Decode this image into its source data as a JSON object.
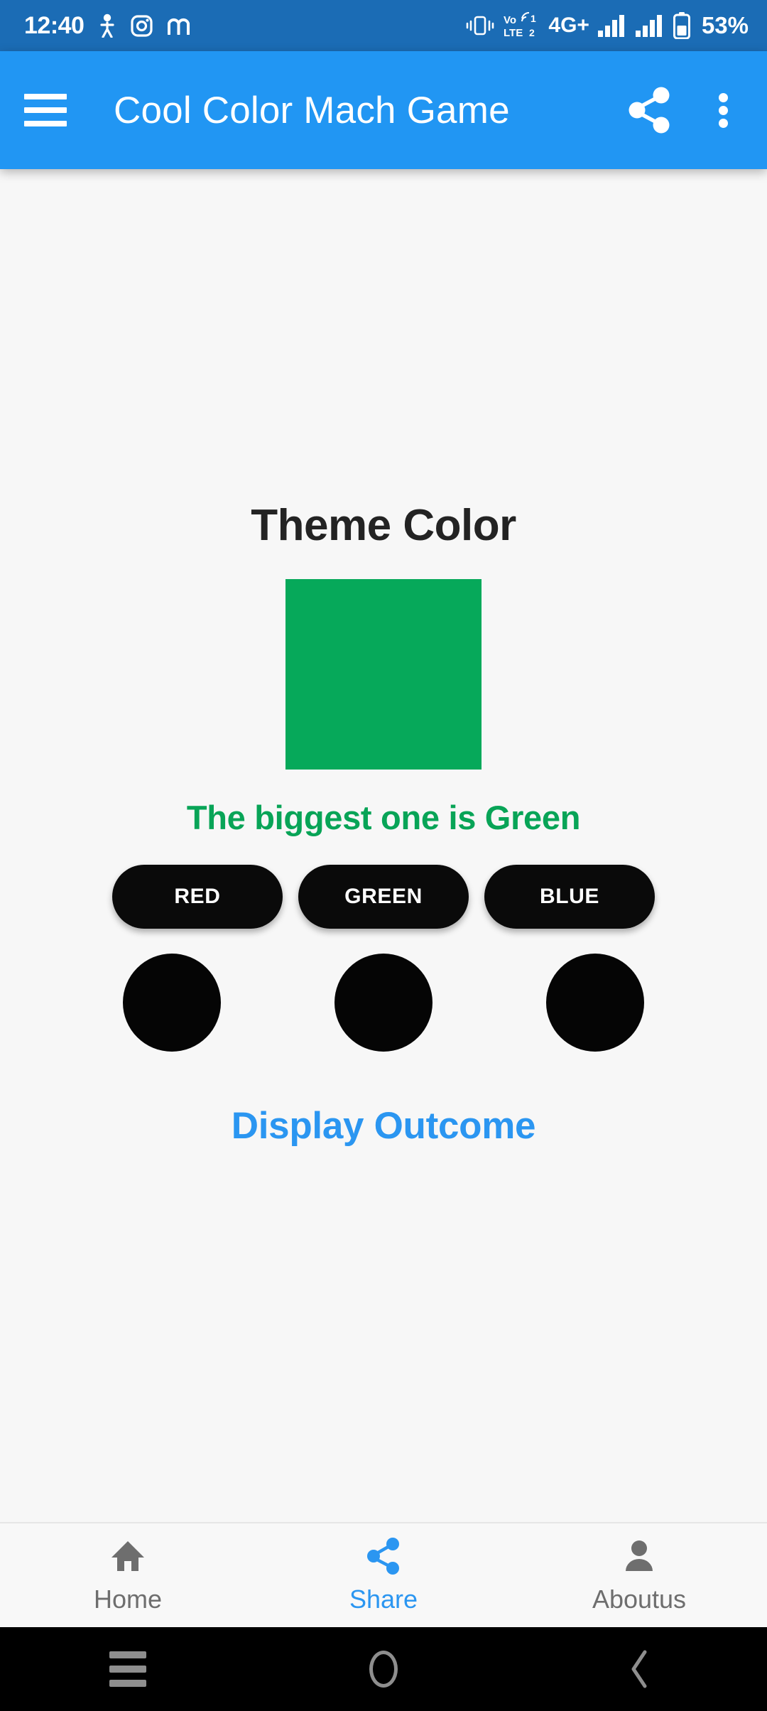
{
  "status_bar": {
    "clock": "12:40",
    "battery_percent": "53%",
    "network_label": "4G+",
    "volte_label": "VoLTE2",
    "icons": [
      "person-icon",
      "instagram-icon",
      "m-app-icon",
      "vibrate-icon",
      "volte-icon",
      "signal-bars-icon",
      "signal-bars-2-icon",
      "battery-icon"
    ],
    "background_color": "#1B6CB5"
  },
  "app_bar": {
    "title": "Cool Color Mach Game",
    "menu_icon": "hamburger-menu-icon",
    "share_icon": "share-icon",
    "overflow_icon": "overflow-menu-icon",
    "background_color": "#2196F3"
  },
  "main": {
    "theme_title": "Theme Color",
    "theme_swatch_color": "#06A95A",
    "result_text": "The biggest one is Green",
    "result_text_color": "#08A457",
    "color_buttons": [
      {
        "label": "RED"
      },
      {
        "label": "GREEN"
      },
      {
        "label": "BLUE"
      }
    ],
    "color_dots": [
      {
        "color": "#050505"
      },
      {
        "color": "#050505"
      },
      {
        "color": "#050505"
      }
    ],
    "display_outcome_label": "Display Outcome",
    "display_outcome_color": "#2B96F1",
    "background_color": "#F7F7F7"
  },
  "bottom_nav": {
    "active_color": "#2B96F1",
    "inactive_color": "#6E6E6E",
    "items": [
      {
        "label": "Home",
        "icon": "home-icon",
        "active": false
      },
      {
        "label": "Share",
        "icon": "share-icon",
        "active": true
      },
      {
        "label": "Aboutus",
        "icon": "person-icon",
        "active": false
      }
    ]
  },
  "system_nav": {
    "background_color": "#000000",
    "buttons": [
      "recents-icon",
      "home-icon",
      "back-icon"
    ]
  }
}
